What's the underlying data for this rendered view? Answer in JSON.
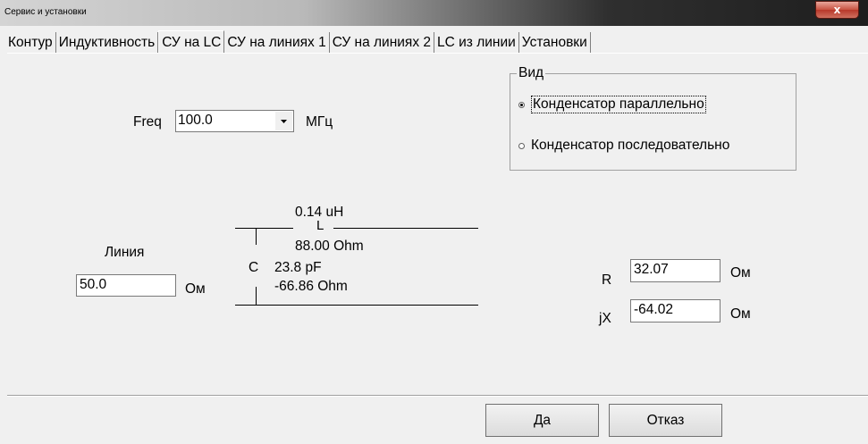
{
  "window": {
    "title": "Сервис и установки",
    "close_glyph": "x"
  },
  "tabs": [
    {
      "label": "Контур"
    },
    {
      "label": "Индуктивность"
    },
    {
      "label": "СУ на LC"
    },
    {
      "label": "СУ на линиях 1"
    },
    {
      "label": "СУ на линиях 2"
    },
    {
      "label": "LC из линии"
    },
    {
      "label": "Установки"
    }
  ],
  "freq": {
    "label": "Freq",
    "value": "100.0",
    "unit": "МГц"
  },
  "view_group": {
    "title": "Вид",
    "options": [
      {
        "label": "Конденсатор параллельно",
        "selected": true
      },
      {
        "label": "Конденсатор последовательно",
        "selected": false
      }
    ]
  },
  "line": {
    "label": "Линия",
    "value": "50.0",
    "unit": "Ом"
  },
  "circuit": {
    "inductance": "0.14 uH",
    "l_label": "L",
    "l_reactance": "88.00 Ohm",
    "c_label": "C",
    "capacitance": "23.8 pF",
    "c_reactance": "-66.86 Ohm"
  },
  "impedance": {
    "r_label": "R",
    "r_value": "32.07",
    "r_unit": "Ом",
    "x_label": "jX",
    "x_value": "-64.02",
    "x_unit": "Ом"
  },
  "buttons": {
    "ok": "Да",
    "cancel": "Отказ"
  }
}
